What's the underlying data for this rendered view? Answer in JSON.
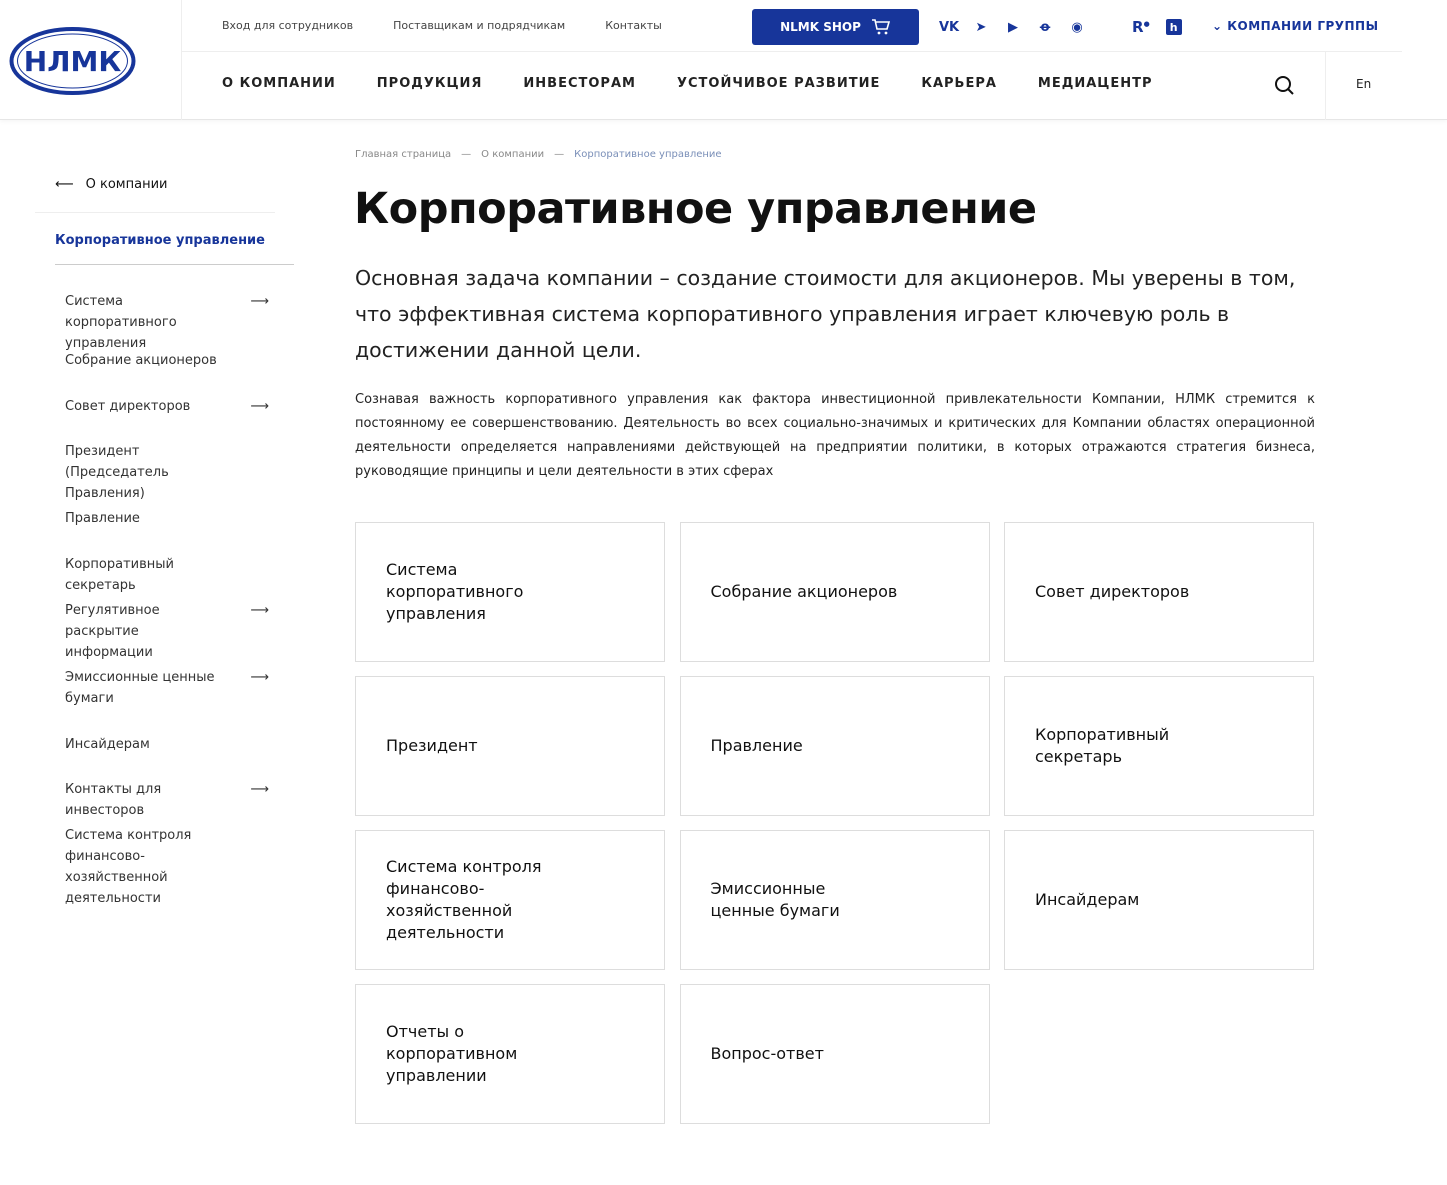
{
  "header": {
    "logo_text": "НЛМК",
    "top_links": [
      "Вход для сотрудников",
      "Поставщикам и подрядчикам",
      "Контакты"
    ],
    "shop_label": "NLMK SHOP",
    "social": [
      "vk-icon",
      "telegram-icon",
      "youtube-icon",
      "odnoklassniki-icon",
      "rutube-icon"
    ],
    "groups_label": "КОМПАНИИ ГРУППЫ",
    "nav": [
      "О КОМПАНИИ",
      "ПРОДУКЦИЯ",
      "ИНВЕСТОРАМ",
      "УСТОЙЧИВОЕ РАЗВИТИЕ",
      "КАРЬЕРА",
      "МЕДИАЦЕНТР"
    ],
    "lang": "En",
    "brand_color": "#17359a"
  },
  "sidebar": {
    "back": "О компании",
    "active": "Корпоративное управление",
    "items": [
      {
        "label": "Система корпоративного управления",
        "arrow": true
      },
      {
        "label": "Собрание акционеров",
        "arrow": false
      },
      {
        "label": "Совет директоров",
        "arrow": true
      },
      {
        "label": "Президент (Председатель Правления)",
        "arrow": false
      },
      {
        "label": "Правление",
        "arrow": false
      },
      {
        "label": "Корпоративный секретарь",
        "arrow": false
      },
      {
        "label": "Регулятивное раскрытие информации",
        "arrow": true
      },
      {
        "label": "Эмиссионные ценные бумаги",
        "arrow": true
      },
      {
        "label": "Инсайдерам",
        "arrow": false
      },
      {
        "label": "Контакты для инвесторов",
        "arrow": true
      },
      {
        "label": "Система контроля финансово-хозяйственной деятельности",
        "arrow": false
      }
    ]
  },
  "breadcrumbs": [
    "Главная страница",
    "О компании",
    "Корпоративное управление"
  ],
  "title": "Корпоративное управление",
  "lead": "Основная задача компании – создание стоимости для акционеров. Мы уверены в том, что эффективная система корпоративного управления играет ключевую роль в достижении данной цели.",
  "paragraph": "Сознавая важность корпоративного управления как фактора инвестиционной привлекательности Компании, НЛМК стремится к постоянному ее совершенствованию. Деятельность во всех социально-значимых и критических для Компании областях операционной деятельности определяется направлениями действующей на предприятии политики, в которых отражаются стратегия бизнеса, руководящие принципы и цели деятельности в этих сферах",
  "cards": [
    "Система корпоративного управления",
    "Собрание акционеров",
    "Совет директоров",
    "Президент",
    "Правление",
    "Корпоративный секретарь",
    "Система контроля финансово-хозяйственной деятельности",
    "Эмиссионные ценные бумаги",
    "Инсайдерам",
    "Отчеты о корпоративном управлении",
    "Вопрос-ответ"
  ]
}
